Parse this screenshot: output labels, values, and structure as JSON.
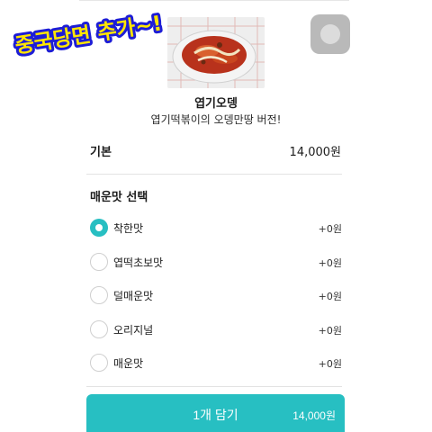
{
  "sticker": {
    "text": "중국당면 추가~!"
  },
  "menu": {
    "name": "엽기오뎅",
    "description": "엽기떡볶이의 오뎅만땅 버전!"
  },
  "base": {
    "label": "기본",
    "price": "14,000원"
  },
  "spice_section": {
    "title": "매운맛 선택",
    "selected": "착한맛",
    "options": [
      {
        "label": "착한맛",
        "price": "+0원"
      },
      {
        "label": "엽떡초보맛",
        "price": "+0원"
      },
      {
        "label": "덜매운맛",
        "price": "+0원"
      },
      {
        "label": "오리지널",
        "price": "+0원"
      },
      {
        "label": "매운맛",
        "price": "+0원"
      }
    ]
  },
  "cart_button": {
    "label": "1개 담기",
    "price": "14,000원"
  },
  "colors": {
    "accent": "#27bfc2",
    "sticker_fill": "#ffe600",
    "sticker_text": "#1d1dd6"
  },
  "icons": {
    "close": "close-icon",
    "radio": "radio-button"
  }
}
